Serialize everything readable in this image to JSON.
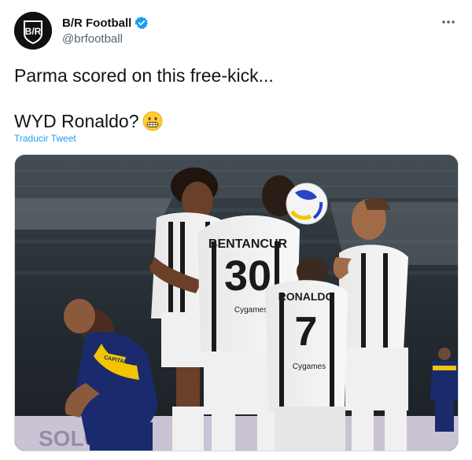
{
  "author": {
    "avatar_text": "B/R",
    "display_name": "B/R Football",
    "handle": "@brfootball",
    "verified": true
  },
  "menu_icon": "more-horizontal-icon",
  "tweet": {
    "line1": "Parma scored on this free-kick...",
    "line2": "WYD Ronaldo?",
    "emoji": "grimacing-face-emoji",
    "translate_label": "Traducir Tweet"
  },
  "photo": {
    "jerseys": {
      "bentancur_name": "BENTANCUR",
      "bentancur_number": "30",
      "ronaldo_name": "RONALDO",
      "ronaldo_number": "7",
      "sponsor": "Cygames",
      "captain_band": "CAPITAN"
    },
    "board_text": "SOLO"
  },
  "colors": {
    "link": "#1d9bf0",
    "secondary_text": "#536471",
    "verified": "#1d9bf0",
    "parma_blue": "#1a2a6c",
    "parma_yellow": "#f2c500"
  }
}
